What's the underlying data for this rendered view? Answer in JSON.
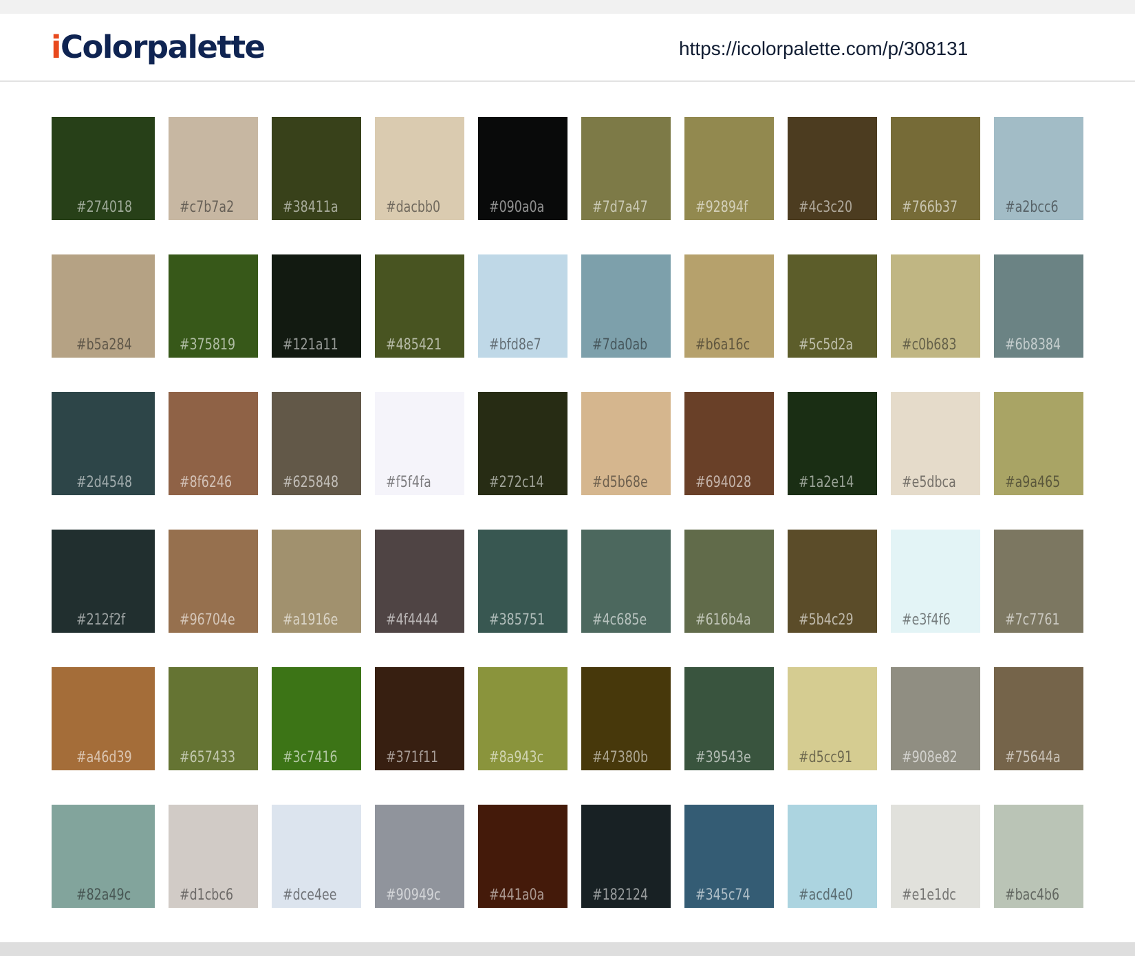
{
  "header": {
    "logo_i": "i",
    "logo_rest": "Colorpalette",
    "url": "https://icolorpalette.com/p/308131"
  },
  "palette": [
    [
      "#274018",
      "#c7b7a2",
      "#38411a",
      "#dacbb0",
      "#090a0a",
      "#7d7a47",
      "#92894f",
      "#4c3c20",
      "#766b37",
      "#a2bcc6"
    ],
    [
      "#b5a284",
      "#375819",
      "#121a11",
      "#485421",
      "#bfd8e7",
      "#7da0ab",
      "#b6a16c",
      "#5c5d2a",
      "#c0b683",
      "#6b8384"
    ],
    [
      "#2d4548",
      "#8f6246",
      "#625848",
      "#f5f4fa",
      "#272c14",
      "#d5b68e",
      "#694028",
      "#1a2e14",
      "#e5dbca",
      "#a9a465"
    ],
    [
      "#212f2f",
      "#96704e",
      "#a1916e",
      "#4f4444",
      "#385751",
      "#4c685e",
      "#616b4a",
      "#5b4c29",
      "#e3f4f6",
      "#7c7761"
    ],
    [
      "#a46d39",
      "#657433",
      "#3c7416",
      "#371f11",
      "#8a943c",
      "#47380b",
      "#39543e",
      "#d5cc91",
      "#908e82",
      "#75644a"
    ],
    [
      "#82a49c",
      "#d1cbc6",
      "#dce4ee",
      "#90949c",
      "#441a0a",
      "#182124",
      "#345c74",
      "#acd4e0",
      "#e1e1dc",
      "#bac4b6"
    ]
  ]
}
